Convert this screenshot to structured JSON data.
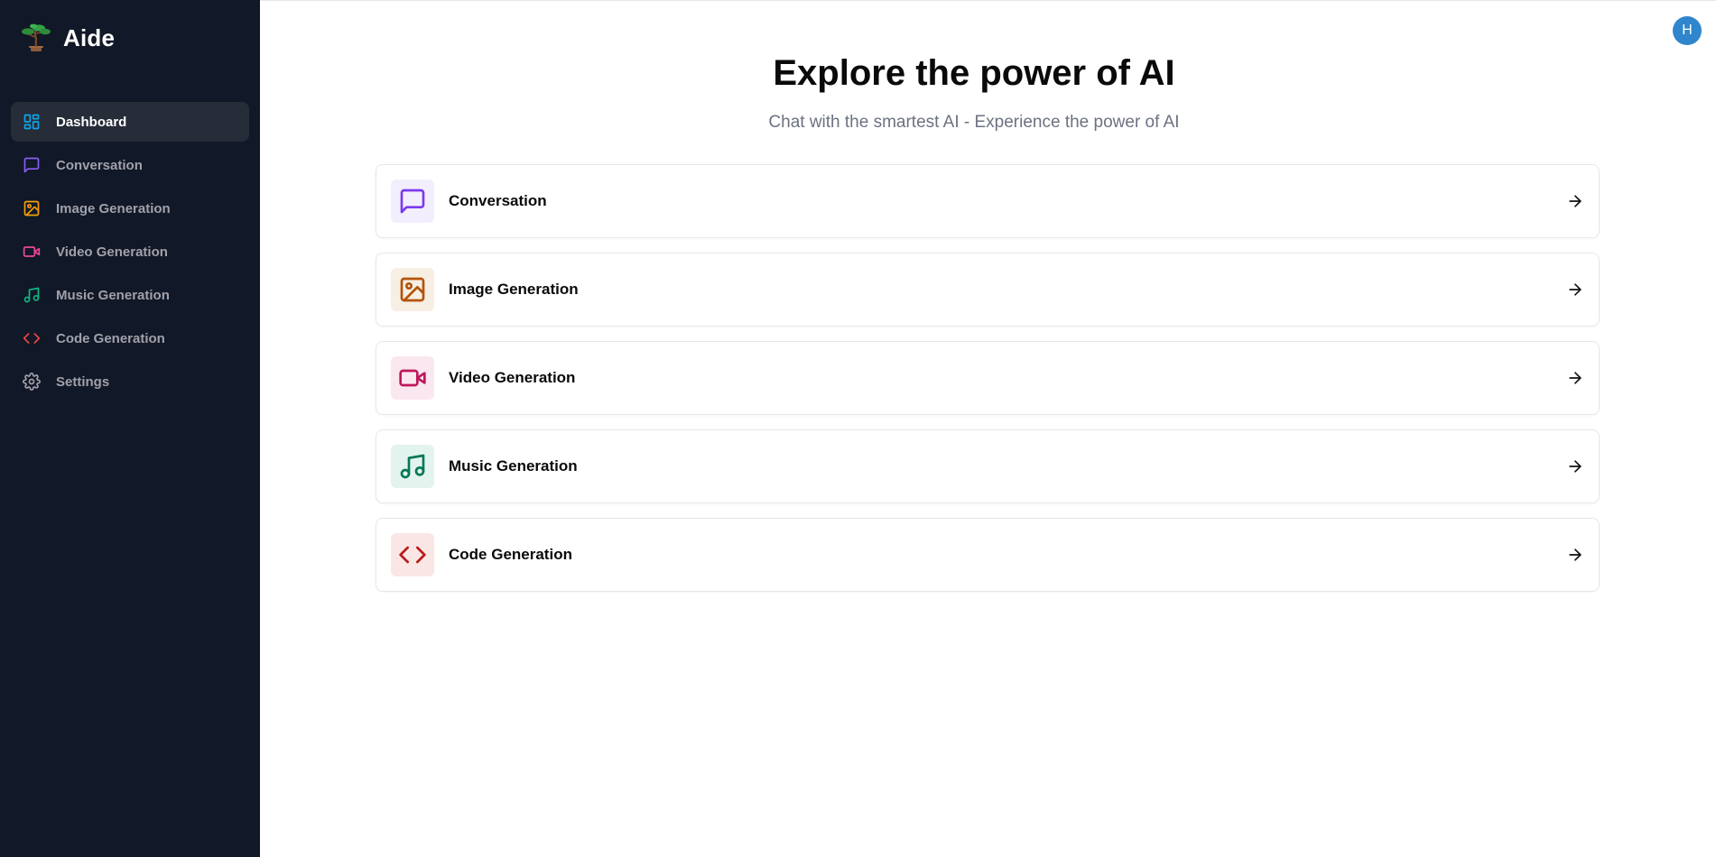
{
  "brand": {
    "name": "Aide",
    "logo_icon": "bonsai-tree-icon"
  },
  "sidebar": {
    "items": [
      {
        "label": "Dashboard",
        "icon": "dashboard-icon",
        "color": "#0ea5e9",
        "active": true
      },
      {
        "label": "Conversation",
        "icon": "message-square-icon",
        "color": "#8b5cf6",
        "active": false
      },
      {
        "label": "Image Generation",
        "icon": "image-icon",
        "color": "#f59e0b",
        "active": false
      },
      {
        "label": "Video Generation",
        "icon": "video-icon",
        "color": "#ec4899",
        "active": false
      },
      {
        "label": "Music Generation",
        "icon": "music-icon",
        "color": "#10b981",
        "active": false
      },
      {
        "label": "Code Generation",
        "icon": "code-icon",
        "color": "#ef4444",
        "active": false
      },
      {
        "label": "Settings",
        "icon": "settings-icon",
        "color": "#a1a1aa",
        "active": false
      }
    ]
  },
  "user": {
    "avatar_initial": "H",
    "avatar_color": "#2f86cc"
  },
  "main": {
    "title": "Explore the power of AI",
    "subtitle": "Chat with the smartest AI - Experience the power of AI",
    "cards": [
      {
        "label": "Conversation",
        "icon": "message-square-icon",
        "color": "#7c3aed",
        "bg": "#f3eefe"
      },
      {
        "label": "Image Generation",
        "icon": "image-icon",
        "color": "#b45309",
        "bg": "#f7efe3"
      },
      {
        "label": "Video Generation",
        "icon": "video-icon",
        "color": "#be185d",
        "bg": "#fbe7ef"
      },
      {
        "label": "Music Generation",
        "icon": "music-icon",
        "color": "#047857",
        "bg": "#e3f3ee"
      },
      {
        "label": "Code Generation",
        "icon": "code-icon",
        "color": "#b91c1c",
        "bg": "#fbe6e6"
      }
    ],
    "arrow_icon": "arrow-right-icon"
  }
}
